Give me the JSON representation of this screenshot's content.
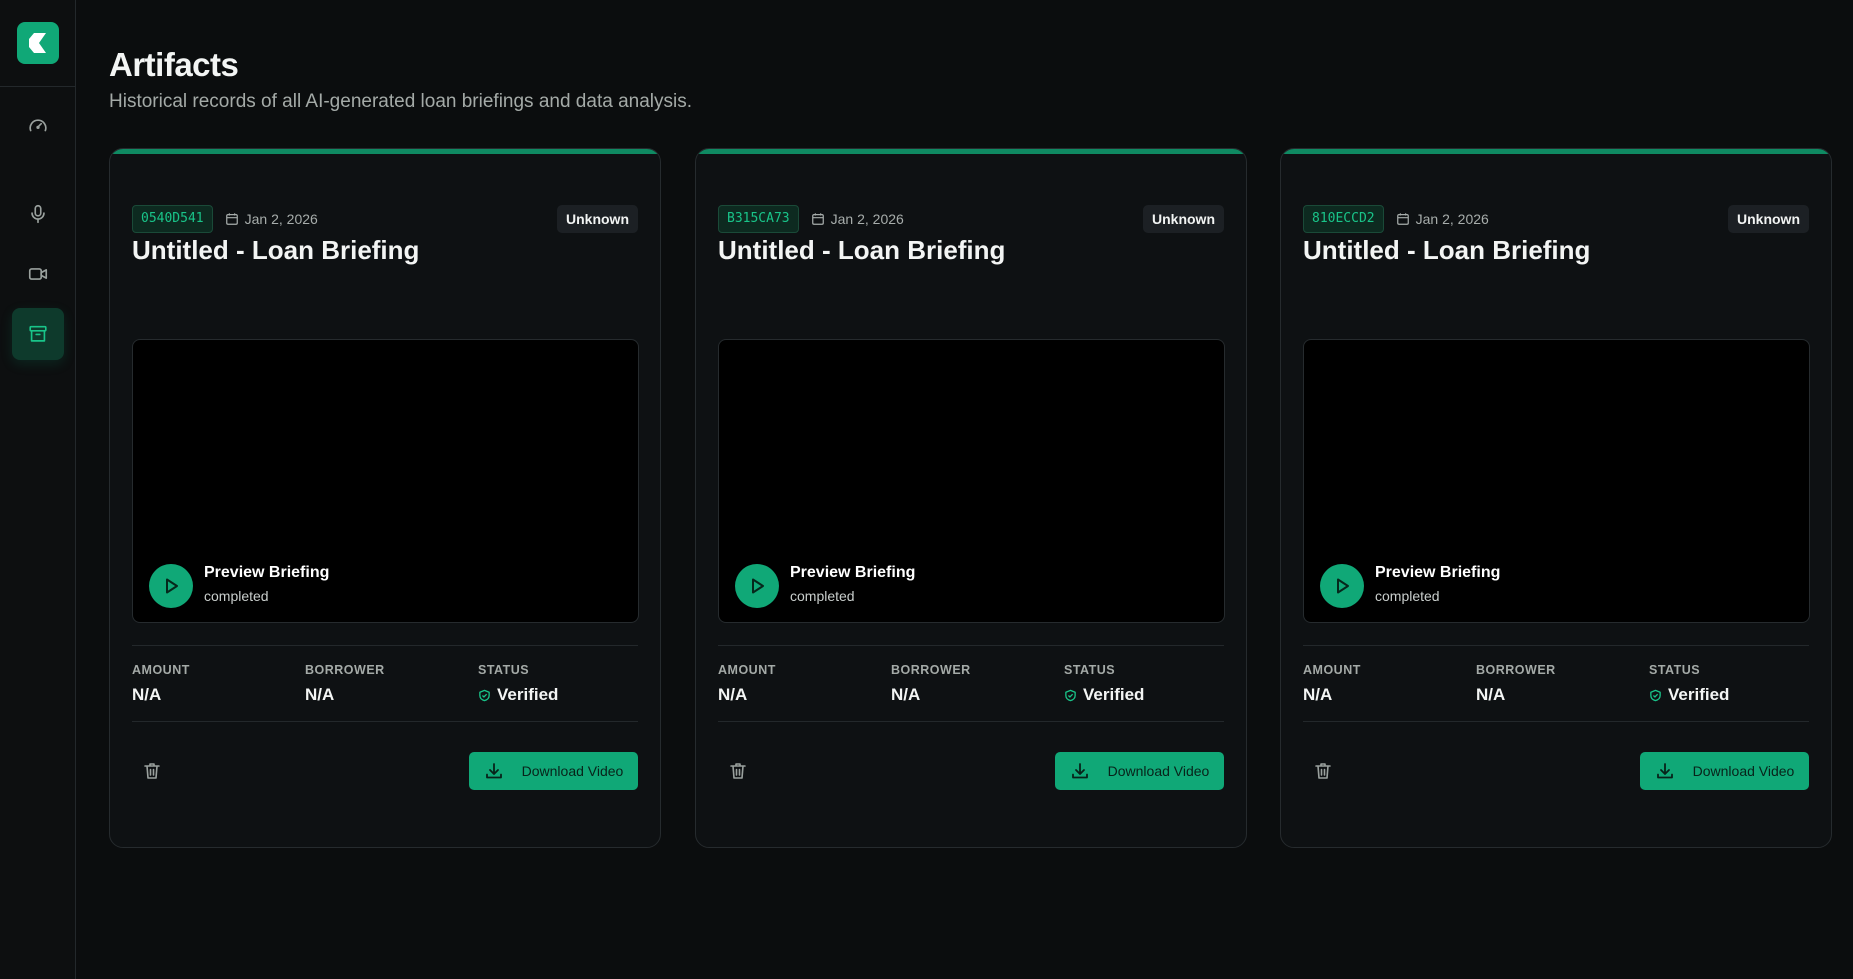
{
  "sidebar": {
    "logo_icon": "app-logo",
    "items": [
      {
        "icon": "gauge-icon",
        "active": false
      },
      {
        "icon": "microphone-icon",
        "active": false
      },
      {
        "icon": "video-camera-icon",
        "active": false
      },
      {
        "icon": "archive-icon",
        "active": true
      }
    ]
  },
  "header": {
    "title": "Artifacts",
    "subtitle": "Historical records of all AI-generated loan briefings and data analysis."
  },
  "colors": {
    "accent": "#10a877",
    "background": "#0b0d0e",
    "card": "#0e1113"
  },
  "cards": [
    {
      "id": "0540D541",
      "date": "Jan 2, 2026",
      "badge": "Unknown",
      "title": "Untitled - Loan Briefing",
      "preview_title": "Preview Briefing",
      "preview_status": "completed",
      "amount_label": "AMOUNT",
      "amount": "N/A",
      "borrower_label": "BORROWER",
      "borrower": "N/A",
      "status_label": "STATUS",
      "status": "Verified",
      "download_label": "Download Video"
    },
    {
      "id": "B315CA73",
      "date": "Jan 2, 2026",
      "badge": "Unknown",
      "title": "Untitled - Loan Briefing",
      "preview_title": "Preview Briefing",
      "preview_status": "completed",
      "amount_label": "AMOUNT",
      "amount": "N/A",
      "borrower_label": "BORROWER",
      "borrower": "N/A",
      "status_label": "STATUS",
      "status": "Verified",
      "download_label": "Download Video"
    },
    {
      "id": "810ECCD2",
      "date": "Jan 2, 2026",
      "badge": "Unknown",
      "title": "Untitled - Loan Briefing",
      "preview_title": "Preview Briefing",
      "preview_status": "completed",
      "amount_label": "AMOUNT",
      "amount": "N/A",
      "borrower_label": "BORROWER",
      "borrower": "N/A",
      "status_label": "STATUS",
      "status": "Verified",
      "download_label": "Download Video"
    }
  ]
}
